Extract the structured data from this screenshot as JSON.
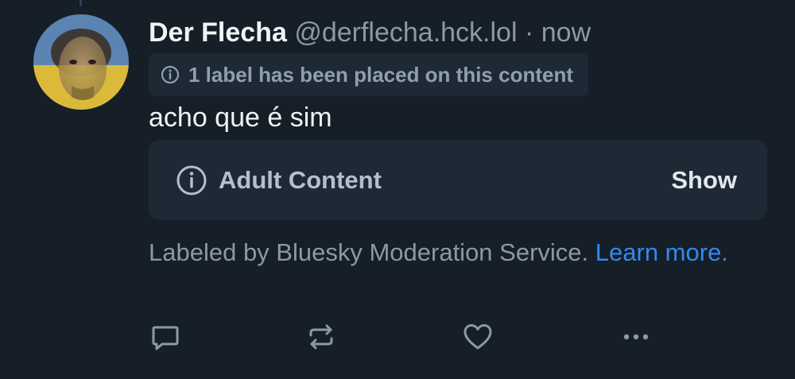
{
  "post": {
    "author": {
      "display_name": "Der Flecha",
      "handle": "@derflecha.hck.lol",
      "avatar": "avatar-photo"
    },
    "separator": "·",
    "timestamp": "now",
    "label_notice": {
      "icon": "info-icon",
      "text": "1 label has been placed on this content"
    },
    "text": "acho que é sim",
    "content_warning": {
      "icon": "info-icon",
      "title": "Adult Content",
      "action_label": "Show"
    },
    "labeled_by": {
      "text": "Labeled by Bluesky Moderation Service.",
      "link_text": "Learn more."
    },
    "actions": [
      {
        "name": "reply",
        "icon": "speech-bubble-icon"
      },
      {
        "name": "repost",
        "icon": "repost-arrows-icon"
      },
      {
        "name": "like",
        "icon": "heart-icon"
      },
      {
        "name": "more",
        "icon": "ellipsis-icon"
      }
    ]
  },
  "colors": {
    "background": "#161e27",
    "card": "#1e2936",
    "text_primary": "#f1f3f5",
    "text_secondary": "#8a99aa",
    "link": "#2f8bf0",
    "icon": "#8a99aa"
  }
}
